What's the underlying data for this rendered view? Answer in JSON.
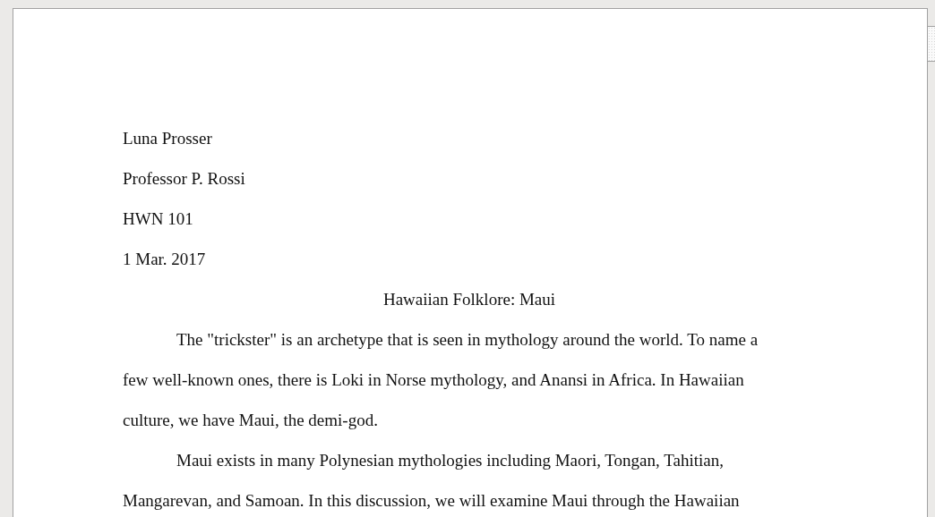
{
  "document": {
    "heading_lines": [
      "Luna Prosser",
      "Professor P. Rossi",
      "HWN 101",
      "1 Mar. 2017"
    ],
    "title": "Hawaiian Folklore: Maui",
    "paragraphs": [
      {
        "lines": [
          "The \"trickster\" is an archetype that is seen in mythology around the world. To name a",
          "few well-known ones, there is Loki in Norse mythology, and Anansi in Africa. In Hawaiian",
          "culture, we have Maui, the demi-god."
        ]
      },
      {
        "lines": [
          "Maui exists in many Polynesian mythologies including Maori, Tongan, Tahitian,",
          "Mangarevan, and Samoan. In this discussion, we will examine Maui through the Hawaiian"
        ]
      }
    ]
  }
}
